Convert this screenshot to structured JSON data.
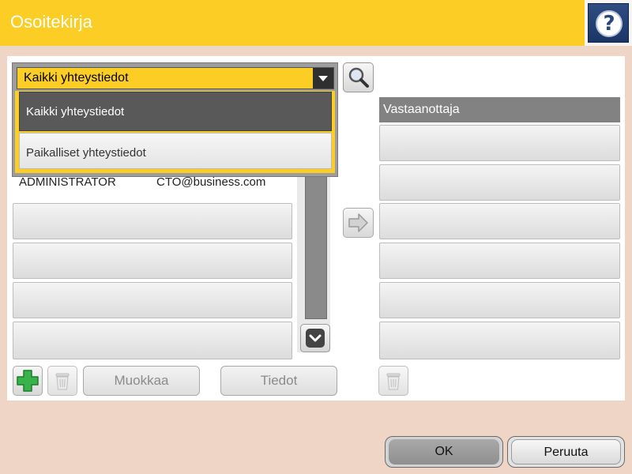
{
  "header": {
    "title": "Osoitekirja",
    "help_label": "?"
  },
  "dropdown": {
    "selected": "Kaikki yhteystiedot",
    "options": [
      "Kaikki yhteystiedot",
      "Paikalliset yhteystiedot"
    ]
  },
  "contacts": [
    {
      "name": "ADMINISTRATOR",
      "email": "CTO@business.com"
    }
  ],
  "recipients": {
    "header": "Vastaanottaja"
  },
  "toolbar": {
    "edit_label": "Muokkaa",
    "info_label": "Tiedot"
  },
  "footer": {
    "ok_label": "OK",
    "cancel_label": "Peruuta"
  },
  "colors": {
    "accent": "#fbcd25",
    "background": "#efd5c5",
    "help_button": "#1c3566"
  },
  "icons": [
    "help-icon",
    "search-icon",
    "chevron-down-icon",
    "arrow-right-icon",
    "add-icon",
    "trash-icon"
  ]
}
